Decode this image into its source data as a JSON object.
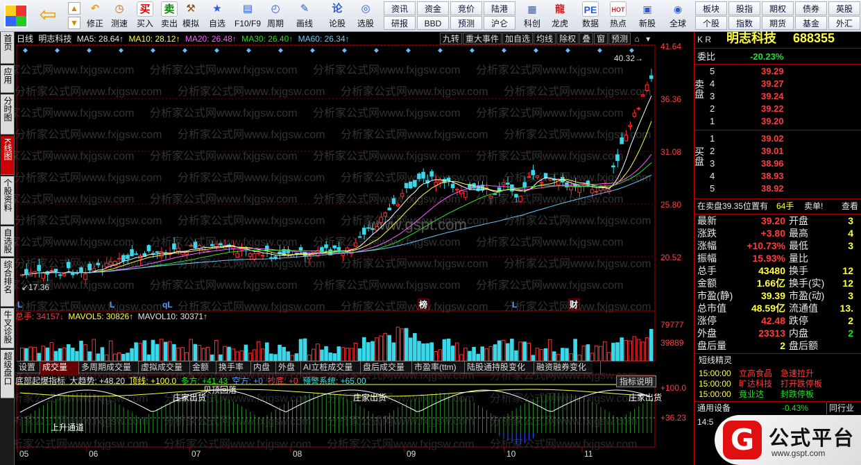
{
  "toolbar": {
    "buttons": [
      {
        "label": "修正",
        "icon": "undo-arrow-icon"
      },
      {
        "label": "测速",
        "icon": "clock-icon"
      },
      {
        "label": "买入",
        "icon": "buy-icon",
        "glyph": "买"
      },
      {
        "label": "卖出",
        "icon": "sell-icon",
        "glyph": "卖"
      },
      {
        "label": "模拟",
        "icon": "hammer-icon"
      },
      {
        "label": "自选",
        "icon": "star-icon"
      },
      {
        "label": "F10/F9",
        "icon": "f10-icon"
      },
      {
        "label": "周期",
        "icon": "period-icon"
      },
      {
        "label": "画线",
        "icon": "pencil-icon"
      },
      {
        "label": "论股",
        "icon": "discuss-icon",
        "glyph": "论"
      },
      {
        "label": "选股",
        "icon": "select-stock-icon"
      }
    ],
    "grid": [
      [
        "资讯",
        "资金",
        "竞价",
        "陆港"
      ],
      [
        "研报",
        "BBD",
        "预测",
        "沪仑"
      ]
    ],
    "buttons2": [
      {
        "label": "科创",
        "icon": "chart-icon"
      },
      {
        "label": "龙虎",
        "icon": "dragon-icon"
      },
      {
        "label": "数据",
        "icon": "pe-icon",
        "glyph": "PE"
      },
      {
        "label": "热点",
        "icon": "hot-icon",
        "glyph": "HOT"
      },
      {
        "label": "新股",
        "icon": "ipo-icon"
      },
      {
        "label": "全球",
        "icon": "globe-icon"
      }
    ],
    "grid2": [
      [
        "板块",
        "股指",
        "期权",
        "债券",
        "英股"
      ],
      [
        "个股",
        "指数",
        "期货",
        "基金",
        "外汇"
      ]
    ]
  },
  "left_tabs": [
    "首页",
    "应用",
    "分时图",
    "K线图",
    "个股资料",
    "自选股",
    "综合排名",
    "牛叉诊股",
    "超级盘口"
  ],
  "header": {
    "period": "日线",
    "name": "明志科技",
    "ma5": "MA5: 28.64↑",
    "ma10": "MA10: 28.12↑",
    "ma20": "MA20: 26.48↑",
    "ma30": "MA30: 26.40↑",
    "ma60": "MA60: 26.34↑",
    "buttons": [
      "九转",
      "重大事件",
      "加自选",
      "均线",
      "除权",
      "叠",
      "窗",
      "预测"
    ]
  },
  "price_axis": [
    "41.64",
    "36.36",
    "31.08",
    "25.80",
    "20.52"
  ],
  "price_high_label": "40.32",
  "price_low_label": "17.36",
  "markers": [
    "L",
    "L",
    "qL",
    "榜",
    "L",
    "财"
  ],
  "watermark_text": "分析家公式网www.fxjgsw.com",
  "center_watermark": "www.gspt.com",
  "volume": {
    "total": "总手: 34157↓",
    "mavol5": "MAVOL5: 30826↑",
    "mavol10": "MAVOL10: 30371↑",
    "axis": [
      "79777",
      "39889"
    ]
  },
  "sub_tabs": [
    "设置",
    "成交量",
    "多周期成交量",
    "虚拟成交量",
    "金额",
    "换手率",
    "内盘",
    "外盘",
    "AI立桩成交量",
    "盘后成交量",
    "市盈率(ttm)",
    "陆股通持股变化",
    "融资融券变化"
  ],
  "indicator": {
    "name": "底部起爆指标",
    "trend": "大趋势: +48.20",
    "top": "顶线: +100.0",
    "long": "多方: +41.43",
    "short": "空方: +0",
    "bottom": "抄底: +0",
    "alert": "预警系统: +65.00",
    "explain": "指标说明",
    "axis": [
      "+100.0",
      "+36.23"
    ],
    "labels": [
      "贝顶回落",
      "庄家出货",
      "庄家出货",
      "庄家出货",
      "上升通道"
    ]
  },
  "months": [
    "05",
    "06",
    "07",
    "08",
    "09",
    "10",
    "11"
  ],
  "quote": {
    "code": "688355",
    "name": "明志科技",
    "kr": "K R",
    "webi_label": "委比",
    "webi": "-20.23%",
    "sell": [
      [
        "5",
        "39.29"
      ],
      [
        "4",
        "39.27"
      ],
      [
        "3",
        "39.24"
      ],
      [
        "2",
        "39.22"
      ],
      [
        "1",
        "39.20"
      ]
    ],
    "buy": [
      [
        "1",
        "39.02"
      ],
      [
        "2",
        "39.01"
      ],
      [
        "3",
        "38.96"
      ],
      [
        "4",
        "38.93"
      ],
      [
        "5",
        "38.92"
      ]
    ],
    "side_sell": "卖盘",
    "side_buy": "买盘",
    "sellmsg": "在卖盘39.35位置有",
    "sellmsg2": "64手",
    "sellmsg3": "卖单!",
    "sellmsg4": "查看",
    "stats": [
      [
        "最新",
        "39.20",
        "开盘",
        "3"
      ],
      [
        "涨跌",
        "+3.80",
        "最高",
        "4"
      ],
      [
        "涨幅",
        "+10.73%",
        "最低",
        "3"
      ],
      [
        "振幅",
        "15.93%",
        "量比",
        ""
      ],
      [
        "总手",
        "43480",
        "换手",
        "12"
      ],
      [
        "金额",
        "1.66亿",
        "换手(实)",
        "12"
      ],
      [
        "市盈(静)",
        "39.39",
        "市盈(动)",
        "3"
      ],
      [
        "总市值",
        "48.59亿",
        "流通值",
        "13."
      ],
      [
        "涨停",
        "42.48",
        "跌停",
        "2"
      ],
      [
        "外盘",
        "23313",
        "内盘",
        "2"
      ],
      [
        "盘后量",
        "2",
        "盘后额",
        ""
      ]
    ],
    "news_title": "短线精灵",
    "news": [
      [
        "15:00:00",
        "立高食品",
        "急速拉升"
      ],
      [
        "15:00:00",
        "旷达科技",
        "打开跌停板"
      ],
      [
        "15:00:00",
        "竟业达",
        "封跌停板"
      ]
    ],
    "industry": "通用设备",
    "industry_pct": "-0.43%",
    "industry_link": "同行业",
    "tick_time": "14:5",
    "tick_price": "39.00",
    "tick_vol": "3"
  },
  "logo_text": "公式平台",
  "logo_url": "www.gspt.com"
}
